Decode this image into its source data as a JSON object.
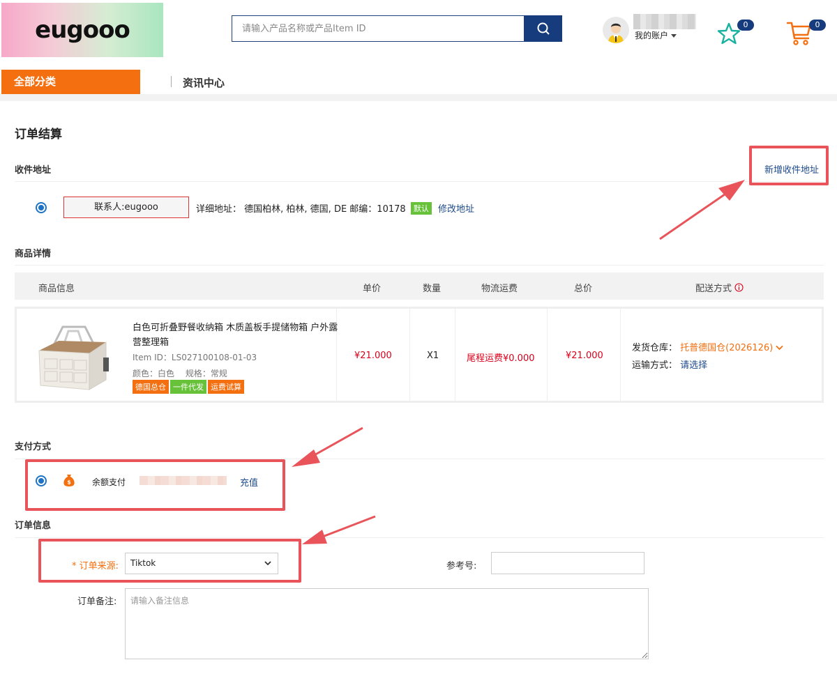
{
  "header": {
    "logo_text": "eugooo",
    "search_placeholder": "请输入产品名称或产品Item ID",
    "account_label": "我的账户",
    "favorites_count": "0",
    "cart_count": "0"
  },
  "nav": {
    "category_label": "全部分类",
    "items": [
      {
        "label": "资讯中心"
      }
    ]
  },
  "page_title": "订单结算",
  "address": {
    "section_title": "收件地址",
    "new_address_link": "新增收件地址",
    "contact": "联系人:eugooo",
    "detail_label": "详细地址：",
    "detail_value": "德国柏林, 柏林, 德国, DE 邮编：10178",
    "default_tag": "默认",
    "edit_link": "修改地址"
  },
  "products": {
    "section_title": "商品详情",
    "columns": [
      "商品信息",
      "单价",
      "数量",
      "物流运费",
      "总价",
      "配送方式"
    ],
    "rows": [
      {
        "name": "白色可折叠野餐收纳箱 木质盖板手提储物箱 户外露营整理箱",
        "item_id": "Item ID：LS027100108-01-03",
        "color": "颜色：白色",
        "spec": "规格：常规",
        "tags": [
          {
            "label": "德国总仓",
            "color": "#f36f0f"
          },
          {
            "label": "一件代发",
            "color": "#67c23a"
          },
          {
            "label": "运费试算",
            "color": "#f36f0f"
          }
        ],
        "unit_price": "¥21.000",
        "quantity": "X1",
        "shipping_fee": "尾程运费¥0.000",
        "total": "¥21.000",
        "warehouse_label": "发货仓库：",
        "warehouse_value": "托普德国仓(2026126)",
        "transport_label": "运输方式：",
        "transport_value": "请选择"
      }
    ]
  },
  "payment": {
    "section_title": "支付方式",
    "method_label": "余额支付",
    "recharge_link": "充值"
  },
  "order_info": {
    "section_title": "订单信息",
    "source_label": "订单来源:",
    "source_value": "Tiktok",
    "reference_label": "参考号:",
    "reference_value": "",
    "remark_label": "订单备注:",
    "remark_placeholder": "请输入备注信息"
  },
  "colors": {
    "brand_orange": "#f36f0f",
    "brand_blue": "#173c7e",
    "link_blue": "#1d4a8a",
    "price_red": "#d9001b",
    "highlight_red": "#e8545a"
  }
}
